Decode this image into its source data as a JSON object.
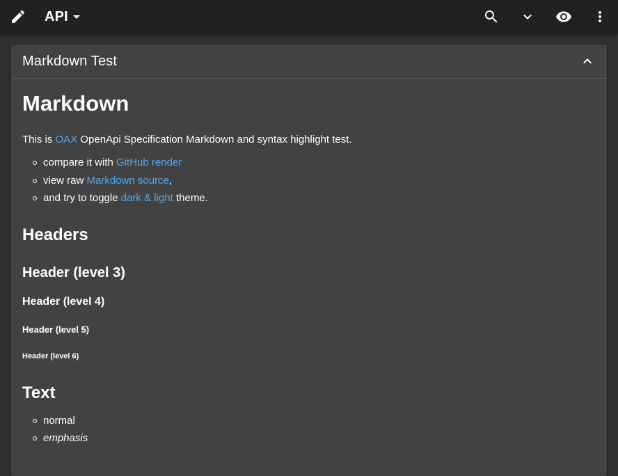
{
  "appbar": {
    "api_label": "API",
    "icons": [
      "pencil-icon",
      "search-icon",
      "chevron-down-icon",
      "eye-icon",
      "more-vert-icon"
    ]
  },
  "panel": {
    "title": "Markdown Test"
  },
  "markdown": {
    "h1": "Markdown",
    "intro_prefix": "This is ",
    "intro_link": "OAX",
    "intro_suffix": " OpenApi Specification Markdown and syntax highlight test.",
    "bullets": [
      {
        "prefix": "compare it with ",
        "link": "GitHub render",
        "suffix": ""
      },
      {
        "prefix": "view raw ",
        "link": "Markdown source",
        "suffix": ","
      },
      {
        "prefix": "and try to toggle ",
        "link": "dark & light",
        "suffix": " theme."
      }
    ],
    "headers_h2": "Headers",
    "h3": "Header (level 3)",
    "h4": "Header (level 4)",
    "h5": "Header (level 5)",
    "h6": "Header (level 6)",
    "text_h2": "Text",
    "text_items": [
      "normal",
      "emphasis"
    ]
  },
  "colors": {
    "appbar_bg": "#212121",
    "page_bg": "#303030",
    "panel_bg": "#424242",
    "link": "#55a6f0",
    "text": "#ffffff"
  }
}
